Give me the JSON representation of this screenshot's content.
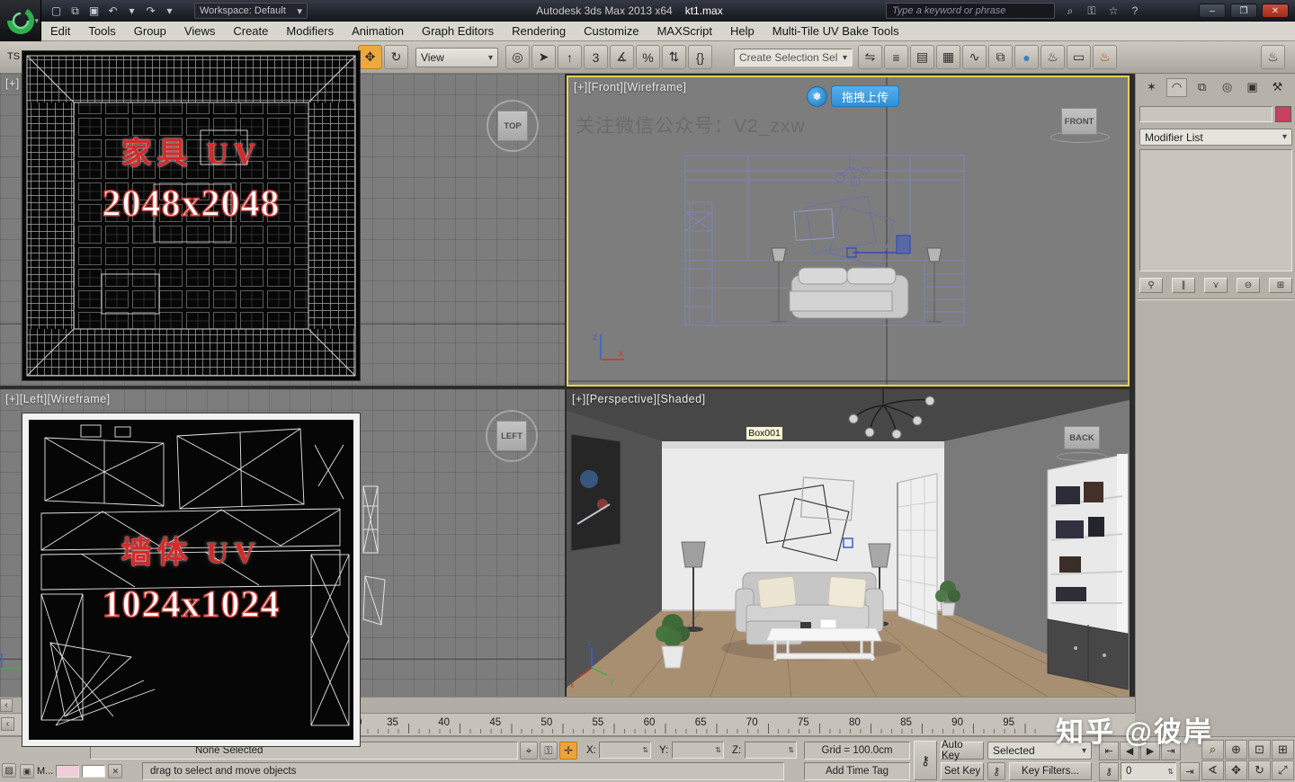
{
  "titlebar": {
    "workspace": "Workspace: Default",
    "app_title": "Autodesk 3ds Max 2013 x64",
    "file_name": "kt1.max",
    "search_placeholder": "Type a keyword or phrase",
    "qat_icons": [
      {
        "name": "new-file-icon",
        "glyph": "▢"
      },
      {
        "name": "open-file-icon",
        "glyph": "⧉"
      },
      {
        "name": "save-file-icon",
        "glyph": "▣"
      },
      {
        "name": "undo-icon",
        "glyph": "↶"
      },
      {
        "name": "undo-dropdown-icon",
        "glyph": "▾"
      },
      {
        "name": "redo-icon",
        "glyph": "↷"
      },
      {
        "name": "redo-dropdown-icon",
        "glyph": "▾"
      }
    ],
    "info_icons": [
      {
        "name": "search-icon",
        "glyph": "⌕"
      },
      {
        "name": "subscription-key-icon",
        "glyph": "⚿"
      },
      {
        "name": "favorites-icon",
        "glyph": "☆"
      },
      {
        "name": "help-icon",
        "glyph": "?"
      }
    ],
    "window_buttons": [
      {
        "name": "minimize-button",
        "glyph": "–"
      },
      {
        "name": "maximize-button",
        "glyph": "❐"
      },
      {
        "name": "close-button",
        "glyph": "✕"
      }
    ]
  },
  "menubar": {
    "items": [
      "Edit",
      "Tools",
      "Group",
      "Views",
      "Create",
      "Modifiers",
      "Animation",
      "Graph Editors",
      "Rendering",
      "Customize",
      "MAXScript",
      "Help",
      "Multi-Tile UV Bake Tools"
    ]
  },
  "toolbar": {
    "dock_label": "TS",
    "view_combo": "View",
    "selection_set_combo": "Create Selection Sel",
    "icons_left": [
      {
        "name": "select-and-move-icon",
        "glyph": "✥",
        "style": "background:#eda83f;border-color:#c07c1d"
      },
      {
        "name": "select-and-rotate-icon",
        "glyph": "↻"
      }
    ],
    "icons_mid": [
      {
        "name": "use-pivot-center-icon",
        "glyph": "◎"
      },
      {
        "name": "select-and-manipulate-icon",
        "glyph": "➤"
      },
      {
        "name": "select-and-place-icon",
        "glyph": "↑"
      },
      {
        "name": "snaps-toggle-icon",
        "glyph": "3"
      },
      {
        "name": "angle-snap-icon",
        "glyph": "∡"
      },
      {
        "name": "percent-snap-icon",
        "glyph": "%"
      },
      {
        "name": "spinner-snap-icon",
        "glyph": "⇅"
      },
      {
        "name": "named-selection-sets-icon",
        "glyph": "{}"
      }
    ],
    "icons_right": [
      {
        "name": "mirror-icon",
        "glyph": "⇋"
      },
      {
        "name": "align-icon",
        "glyph": "≡"
      },
      {
        "name": "layer-manager-icon",
        "glyph": "▤"
      },
      {
        "name": "graphite-ribbon-icon",
        "glyph": "▦"
      },
      {
        "name": "curve-editor-icon",
        "glyph": "∿"
      },
      {
        "name": "schematic-view-icon",
        "glyph": "⧉"
      },
      {
        "name": "material-editor-icon",
        "glyph": "●",
        "style": "color:#2e86c1"
      },
      {
        "name": "render-setup-icon",
        "glyph": "♨"
      },
      {
        "name": "rendered-frame-icon",
        "glyph": "▭"
      },
      {
        "name": "render-production-icon",
        "glyph": "♨",
        "style": "color:#b34700"
      }
    ],
    "icons_far": [
      {
        "name": "render-flyout-icon",
        "glyph": "♨"
      }
    ]
  },
  "viewports": {
    "top": {
      "label": "[+]",
      "viewcube": "TOP"
    },
    "front": {
      "label": "[+][Front][Wireframe]",
      "viewcube": "FRONT",
      "upload_button": "拖拽上传",
      "upload_badge": "✽",
      "watermark": "关注微信公众号：V2_zxw"
    },
    "left": {
      "label": "[+][Left][Wireframe]",
      "viewcube": "LEFT"
    },
    "perspective": {
      "label": "[+][Perspective][Shaded]",
      "viewcube": "BACK",
      "object_label": "Box001"
    }
  },
  "uv_overlays": {
    "furniture": {
      "title": "家具 UV",
      "resolution": "2048x2048"
    },
    "wall": {
      "title": "墙体 UV",
      "resolution": "1024x1024"
    }
  },
  "command_panel": {
    "tabs": [
      {
        "name": "tab-create-icon",
        "glyph": "✶"
      },
      {
        "name": "tab-modify-icon",
        "glyph": "◠",
        "style": "background:#c9c5bd;border:1px solid #8a867e"
      },
      {
        "name": "tab-hierarchy-icon",
        "glyph": "⧉"
      },
      {
        "name": "tab-motion-icon",
        "glyph": "◎"
      },
      {
        "name": "tab-display-icon",
        "glyph": "▣"
      },
      {
        "name": "tab-utilities-icon",
        "glyph": "⚒"
      }
    ],
    "modifier_list_label": "Modifier List",
    "stack_buttons": [
      {
        "name": "pin-stack-icon",
        "glyph": "⚲"
      },
      {
        "name": "show-end-result-icon",
        "glyph": "∥"
      },
      {
        "name": "make-unique-icon",
        "glyph": "⋎"
      },
      {
        "name": "remove-modifier-icon",
        "glyph": "⊖"
      },
      {
        "name": "configure-modifier-sets-icon",
        "glyph": "⊞"
      }
    ]
  },
  "timeline": {
    "slider_arrow": "‹",
    "partial_tick": "0",
    "ticks": [
      "35",
      "40",
      "45",
      "50",
      "55",
      "60",
      "65",
      "70",
      "75",
      "80",
      "85",
      "90",
      "95"
    ]
  },
  "status_bar": {
    "selection_status": "None Selected",
    "prompt": "drag to select and move objects",
    "coord_x_label": "X:",
    "coord_y_label": "Y:",
    "coord_z_label": "Z:",
    "grid_label": "Grid = 100.0cm",
    "add_time_tag": "Add Time Tag",
    "auto_key_label": "Auto Key",
    "set_key_label": "Set Key",
    "selected_filter": "Selected",
    "key_filters_label": "Key Filters...",
    "frame_field": "0",
    "listener_label": "M...",
    "listener_icon": "▣",
    "listener_close": "✕",
    "corner_glyph": "▨",
    "set_keys_glyph": "⚷",
    "key_filter_icon_glyph": "⚷",
    "key_mode_glyph": "⚷",
    "end_glyph": "⇥",
    "selection_icons": [
      {
        "name": "selection-region-icon",
        "glyph": "⌖"
      },
      {
        "name": "selection-lock-icon",
        "glyph": "⚿"
      },
      {
        "name": "absolute-mode-icon",
        "glyph": "✛",
        "style": "background:#eda33c;border-color:#b97f1e"
      }
    ],
    "playback_row1": [
      {
        "name": "go-to-start-button",
        "glyph": "⇤"
      },
      {
        "name": "previous-frame-button",
        "glyph": "◀"
      },
      {
        "name": "play-button",
        "glyph": "▶"
      },
      {
        "name": "go-to-end-button",
        "glyph": "⇥"
      }
    ],
    "nav_row1": [
      {
        "name": "zoom-icon",
        "glyph": "⌕"
      },
      {
        "name": "zoom-all-icon",
        "glyph": "⊕"
      },
      {
        "name": "zoom-extents-icon",
        "glyph": "⊡"
      },
      {
        "name": "zoom-extents-all-icon",
        "glyph": "⊞"
      }
    ],
    "nav_row2": [
      {
        "name": "field-of-view-icon",
        "glyph": "∢"
      },
      {
        "name": "pan-icon",
        "glyph": "✥"
      },
      {
        "name": "orbit-icon",
        "glyph": "↻"
      },
      {
        "name": "maximize-viewport-toggle-icon",
        "glyph": "⤢"
      }
    ]
  },
  "watermark": "知乎 @彼岸",
  "ui": {
    "caret": "▾",
    "spinner": "⇅"
  },
  "colors": {
    "active_viewport_border": "#e8d44a",
    "upload_button_blue": "#3b9be1",
    "object_color_swatch": "#c9415f",
    "uv_text_red": "#d42a2a",
    "viewport_gray": "#7d7d7d"
  }
}
